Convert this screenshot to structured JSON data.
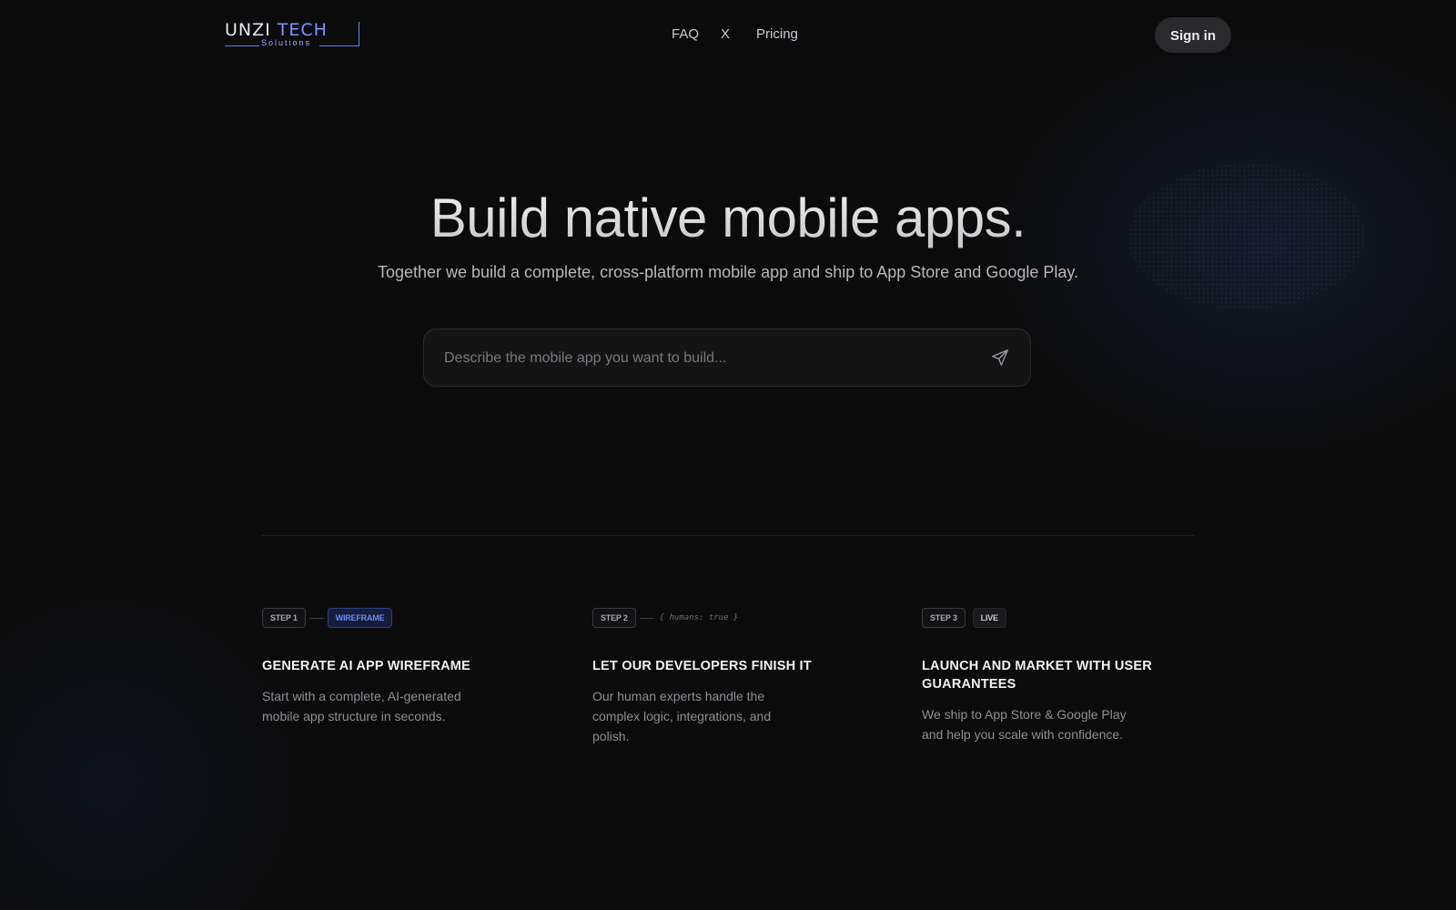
{
  "header": {
    "logo": {
      "main_left": "UNZI",
      "main_right": "TECH",
      "sub": "Solutions",
      "icon": "logo-bracket-icon",
      "accent_color": "#7d95ff"
    },
    "nav": {
      "faq": "FAQ",
      "x": "X",
      "pricing": "Pricing"
    },
    "sign_in": "Sign in"
  },
  "hero": {
    "title": "Build native mobile apps.",
    "subtitle": "Together we build a complete, cross-platform mobile app and ship to App Store and Google Play.",
    "prompt": {
      "placeholder": "Describe the mobile app you want to build...",
      "value": "",
      "send_icon": "send-icon"
    }
  },
  "steps": [
    {
      "tag": "STEP 1",
      "badge": "WIREFRAME",
      "title": "GENERATE AI APP WIREFRAME",
      "description": "Start with a complete, AI-generated mobile app structure in seconds."
    },
    {
      "tag": "STEP 2",
      "note": "{ humans: true }",
      "title": "LET OUR DEVELOPERS FINISH IT",
      "description": "Our human experts handle the complex logic, integrations, and polish."
    },
    {
      "tag": "STEP 3",
      "badge": "LIVE",
      "title": "LAUNCH AND MARKET WITH USER GUARANTEES",
      "description": "We ship to App Store & Google Play and help you scale with confidence."
    }
  ],
  "colors": {
    "background": "#0b0b0c",
    "button_bg": "#2a2a2d",
    "wireframe_badge": "#6f88f5"
  }
}
